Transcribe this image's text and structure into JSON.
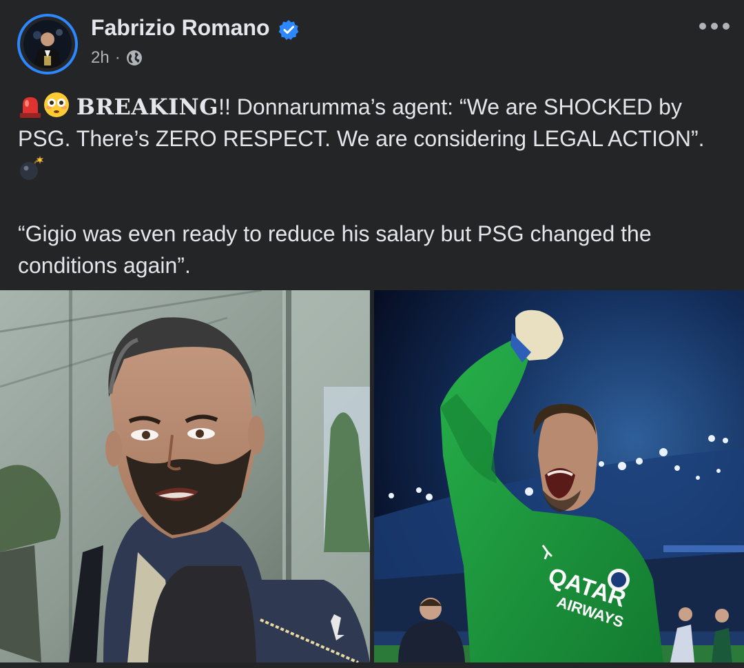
{
  "post": {
    "author": "Fabrizio Romano",
    "time": "2h",
    "separator": "·",
    "text": {
      "breaking": "BREAKING",
      "line1_rest": "!! Donnarumma’s agent: “We are SHOCKED by PSG. There’s ZERO RESPECT. We are considering LEGAL ACTION”.",
      "paragraph2": "“Gigio was even ready to reduce his salary but PSG changed the conditions again”."
    },
    "emojis": [
      "rotating-light-icon",
      "flushed-face-icon",
      "bomb-icon"
    ]
  },
  "colors": {
    "background": "#242526",
    "text": "#e4e6eb",
    "secondary_text": "#b0b3b8",
    "verified_blue": "#2d88ff",
    "jersey_green": "#1f9a3c"
  },
  "images": [
    {
      "name": "agent-photo"
    },
    {
      "name": "goalkeeper-photo",
      "jersey_text": "QATAR AIRWAYS"
    }
  ]
}
